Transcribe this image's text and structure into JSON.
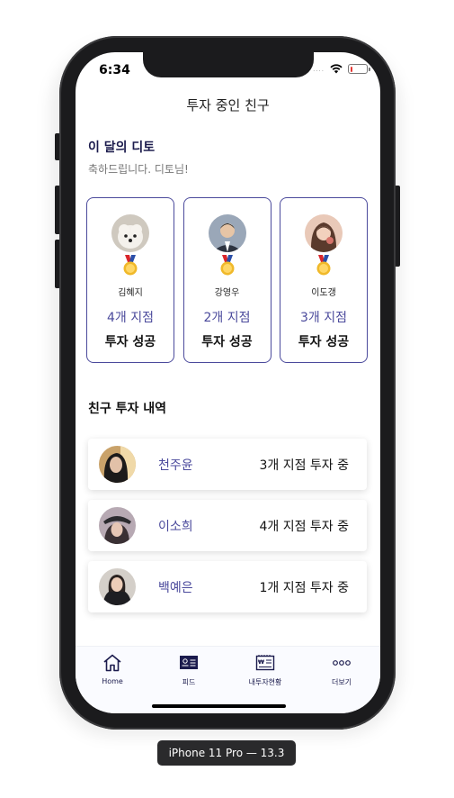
{
  "status_bar": {
    "time": "6:34",
    "signal": "....",
    "battery_level": 0.15
  },
  "header": {
    "title": "투자 중인 친구"
  },
  "monthly": {
    "title": "이 달의 디토",
    "subtitle": "축하드립니다. 디토님!",
    "cards": [
      {
        "name": "김혜지",
        "count": "4개 지점",
        "result": "투자 성공"
      },
      {
        "name": "강영우",
        "count": "2개 지점",
        "result": "투자 성공"
      },
      {
        "name": "이도갱",
        "count": "3개 지점",
        "result": "투자 성공"
      }
    ]
  },
  "history": {
    "title": "친구 투자 내역",
    "items": [
      {
        "name": "천주윤",
        "status": "3개 지점 투자 중"
      },
      {
        "name": "이소희",
        "status": "4개 지점 투자 중"
      },
      {
        "name": "백예은",
        "status": "1개 지점 투자 중"
      }
    ]
  },
  "tabbar": {
    "home": "Home",
    "feed": "피드",
    "my_investments": "내투자현황",
    "more": "더보기"
  },
  "simulator": {
    "label": "iPhone 11 Pro — 13.3"
  },
  "colors": {
    "accent": "#4b4a9c",
    "navy": "#1b1b4d",
    "battery": "#e53935"
  }
}
